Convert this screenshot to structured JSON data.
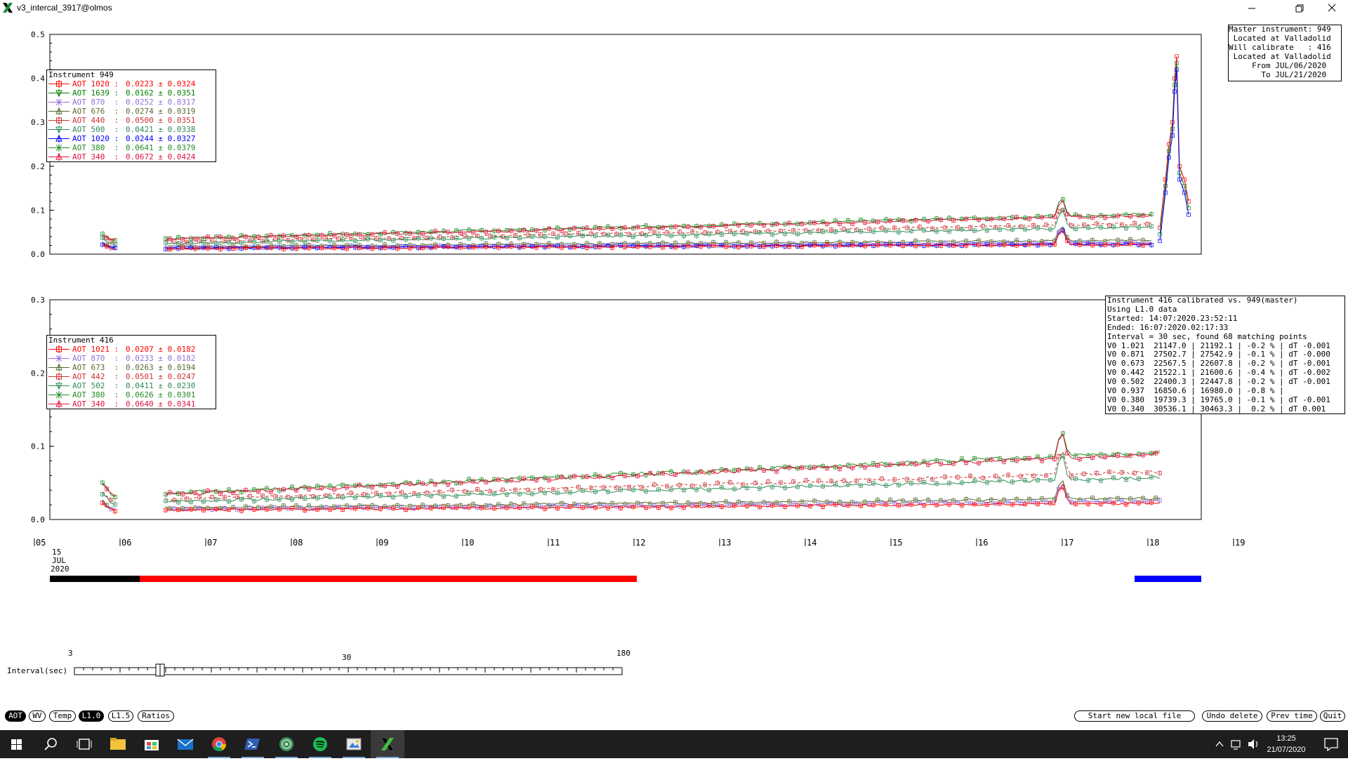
{
  "window": {
    "title": "v3_intercal_3917@olmos",
    "buttons": [
      "minimize",
      "restore",
      "close"
    ]
  },
  "top_plot": {
    "y_ticks": [
      "0.0",
      "0.1",
      "0.2",
      "0.3",
      "0.4",
      "0.5"
    ],
    "legend": {
      "title": "Instrument 949",
      "rows": [
        {
          "label": "AOT 1020 :",
          "value": "0.0223 ± 0.0324",
          "color": "#ff0000",
          "symbol": "square"
        },
        {
          "label": "AOT 1639 :",
          "value": "0.0162 ± 0.0351",
          "color": "#008000",
          "symbol": "tri-down"
        },
        {
          "label": "AOT 870  :",
          "value": "0.0252 ± 0.0317",
          "color": "#9370db",
          "symbol": "cross"
        },
        {
          "label": "AOT 676  :",
          "value": "0.0274 ± 0.0319",
          "color": "#556b2f",
          "symbol": "triangle"
        },
        {
          "label": "AOT 440  :",
          "value": "0.0500 ± 0.0351",
          "color": "#cd3333",
          "symbol": "square"
        },
        {
          "label": "AOT 500  :",
          "value": "0.0421 ± 0.0338",
          "color": "#2e8b57",
          "symbol": "tri-down"
        },
        {
          "label": "AOT 1020 :",
          "value": "0.0244 ± 0.0327",
          "color": "#0000ff",
          "symbol": "triangle"
        },
        {
          "label": "AOT 380  :",
          "value": "0.0641 ± 0.0379",
          "color": "#228b22",
          "symbol": "cross"
        },
        {
          "label": "AOT 340  :",
          "value": "0.0672 ± 0.0424",
          "color": "#dc143c",
          "symbol": "triangle"
        }
      ]
    },
    "info": [
      "Master instrument: 949",
      " Located at Valladolid",
      "Will calibrate   : 416",
      " Located at Valladolid",
      "     From JUL/06/2020",
      "       To JUL/21/2020"
    ]
  },
  "bottom_plot": {
    "y_ticks": [
      "0.0",
      "0.1",
      "0.2",
      "0.3"
    ],
    "legend": {
      "title": "Instrument 416",
      "rows": [
        {
          "label": "AOT 1021 :",
          "value": "0.0207 ± 0.0182",
          "color": "#ff0000",
          "symbol": "square"
        },
        {
          "label": "AOT 870  :",
          "value": "0.0233 ± 0.0182",
          "color": "#9370db",
          "symbol": "cross"
        },
        {
          "label": "AOT 673  :",
          "value": "0.0263 ± 0.0194",
          "color": "#556b2f",
          "symbol": "triangle"
        },
        {
          "label": "AOT 442  :",
          "value": "0.0501 ± 0.0247",
          "color": "#cd3333",
          "symbol": "square"
        },
        {
          "label": "AOT 502  :",
          "value": "0.0411 ± 0.0230",
          "color": "#2e8b57",
          "symbol": "tri-down"
        },
        {
          "label": "AOT 380  :",
          "value": "0.0626 ± 0.0301",
          "color": "#228b22",
          "symbol": "cross"
        },
        {
          "label": "AOT 340  :",
          "value": "0.0640 ± 0.0341",
          "color": "#dc143c",
          "symbol": "triangle"
        }
      ]
    },
    "info": [
      "Instrument 416 calibrated vs. 949(master)",
      "Using L1.0 data",
      "Started: 14:07:2020.23:52:11",
      "Ended: 16:07:2020.02:17:33",
      "Interval = 30 sec, found 68 matching points",
      "V0 1.021  21147.0 | 21192.1 | -0.2 % | dT -0.001",
      "V0 0.871  27502.7 | 27542.9 | -0.1 % | dT -0.000",
      "V0 0.673  22567.5 | 22607.8 | -0.2 % | dT -0.001",
      "V0 0.442  21522.1 | 21600.6 | -0.4 % | dT -0.002",
      "V0 0.502  22400.3 | 22447.8 | -0.2 % | dT -0.001",
      "V0 0.937  16850.6 | 16980.0 | -0.8 % |",
      "V0 0.380  19739.3 | 19765.0 | -0.1 % | dT -0.001",
      "V0 0.340  30536.1 | 30463.3 |  0.2 % | dT 0.001"
    ]
  },
  "time_axis": {
    "labels": [
      "05",
      "06",
      "07",
      "08",
      "09",
      "10",
      "11",
      "12",
      "13",
      "14",
      "15",
      "16",
      "17",
      "18",
      "19"
    ],
    "date_label": [
      "15",
      "JUL",
      "2020"
    ],
    "range_bar_colors": {
      "black": "#000000",
      "red": "#ff0000",
      "blue": "#0000ff"
    }
  },
  "interval_slider": {
    "label": "Interval(sec)",
    "min_label": "3",
    "mid_label": "30",
    "max_label": "180",
    "value": 30
  },
  "mode_buttons": [
    {
      "label": "AOT",
      "active": true
    },
    {
      "label": "WV",
      "active": false
    },
    {
      "label": "Temp",
      "active": false
    },
    {
      "label": "L1.0",
      "active": true
    },
    {
      "label": "L1.5",
      "active": false
    },
    {
      "label": "Ratios",
      "active": false
    }
  ],
  "action_buttons": [
    {
      "label": "Start new local file"
    },
    {
      "label": "Undo delete"
    },
    {
      "label": "Prev time"
    },
    {
      "label": "Quit"
    }
  ],
  "taskbar": {
    "apps": [
      "start-icon",
      "search-icon",
      "task-view-icon",
      "file-explorer-icon",
      "store-icon",
      "mail-icon",
      "chrome-icon",
      "powershell-icon",
      "browser-icon",
      "spotify-icon",
      "paint-icon",
      "x-server-icon"
    ],
    "time": "13:25",
    "date": "21/07/2020"
  }
}
